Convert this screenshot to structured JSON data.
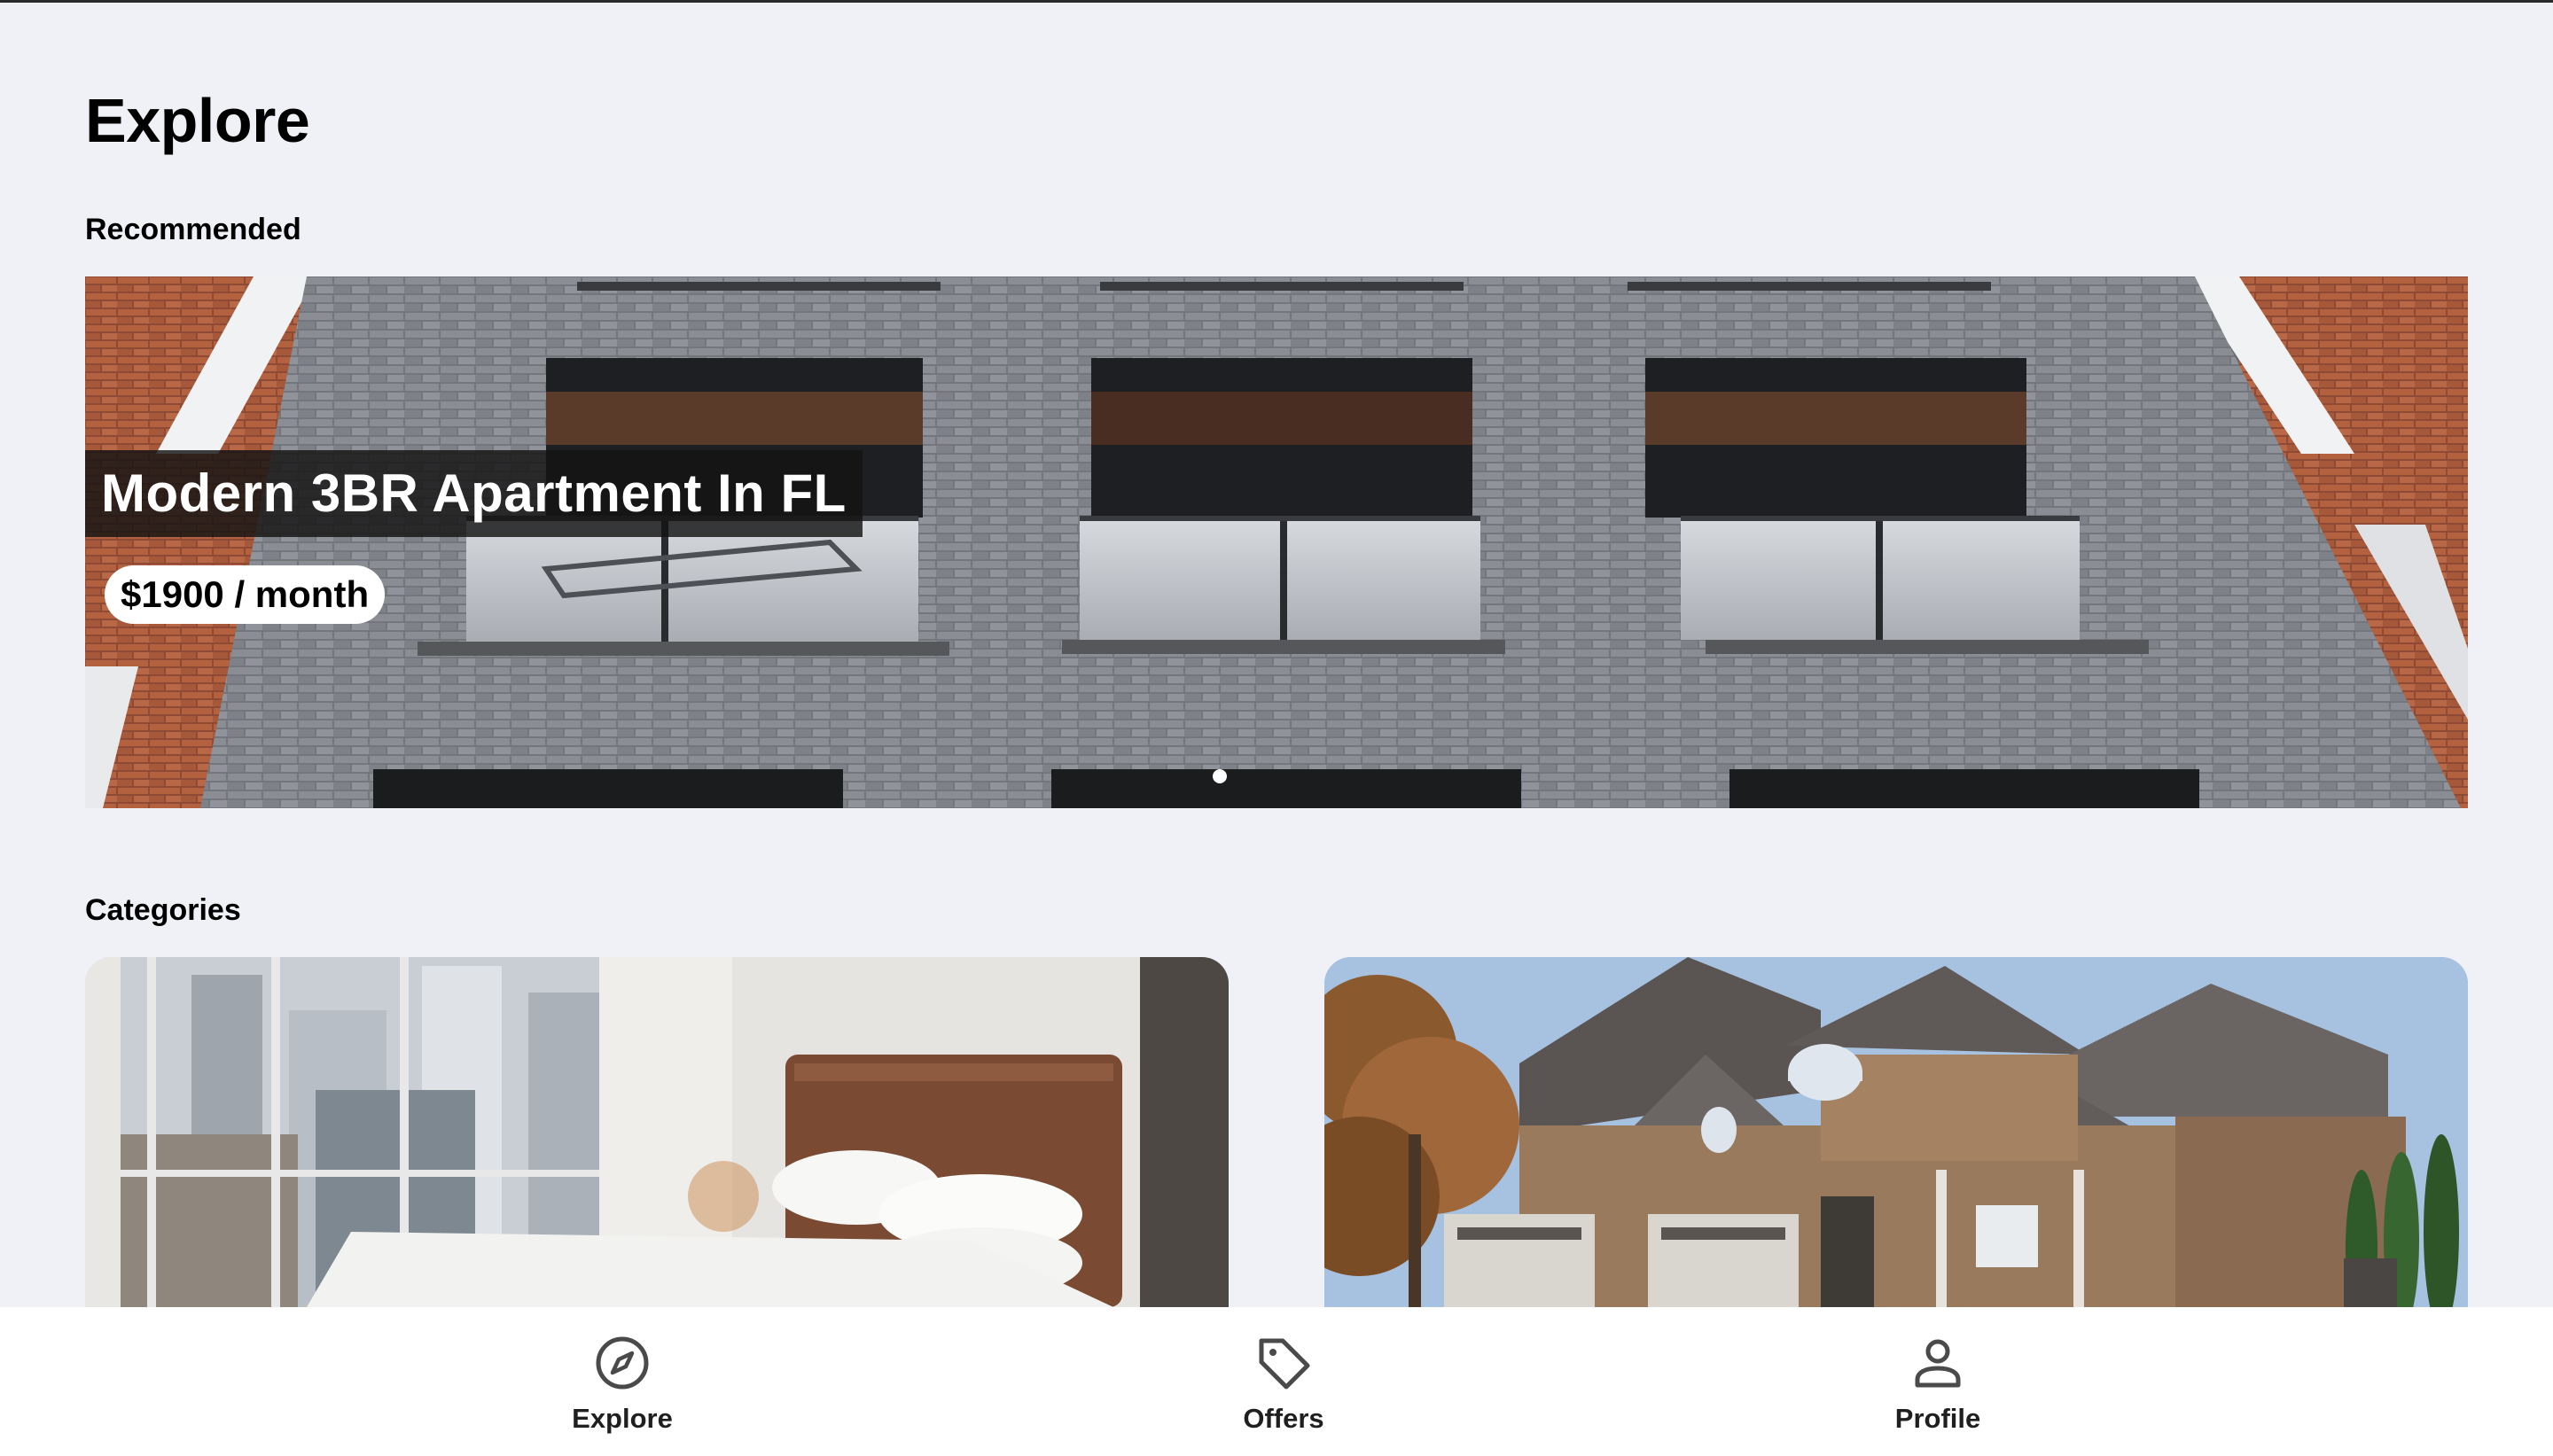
{
  "page": {
    "title": "Explore"
  },
  "recommended": {
    "section_title": "Recommended",
    "listings": [
      {
        "title": "Modern 3BR Apartment In FL",
        "price": "$1900 / month",
        "image": "brick-apartment-building-photo"
      }
    ],
    "active_slide": 1,
    "slide_count": 1
  },
  "categories": {
    "section_title": "Categories",
    "cards": [
      {
        "image": "bedroom-with-city-view-photo"
      },
      {
        "image": "suburban-brick-house-photo"
      }
    ]
  },
  "bottom_nav": {
    "items": [
      {
        "label": "Explore",
        "icon": "compass-icon"
      },
      {
        "label": "Offers",
        "icon": "tag-icon"
      },
      {
        "label": "Profile",
        "icon": "person-icon"
      }
    ]
  },
  "colors": {
    "background": "#f0f1f6",
    "nav_background": "#ffffff",
    "title_overlay": "#141414",
    "icon": "#4a4a4a"
  }
}
